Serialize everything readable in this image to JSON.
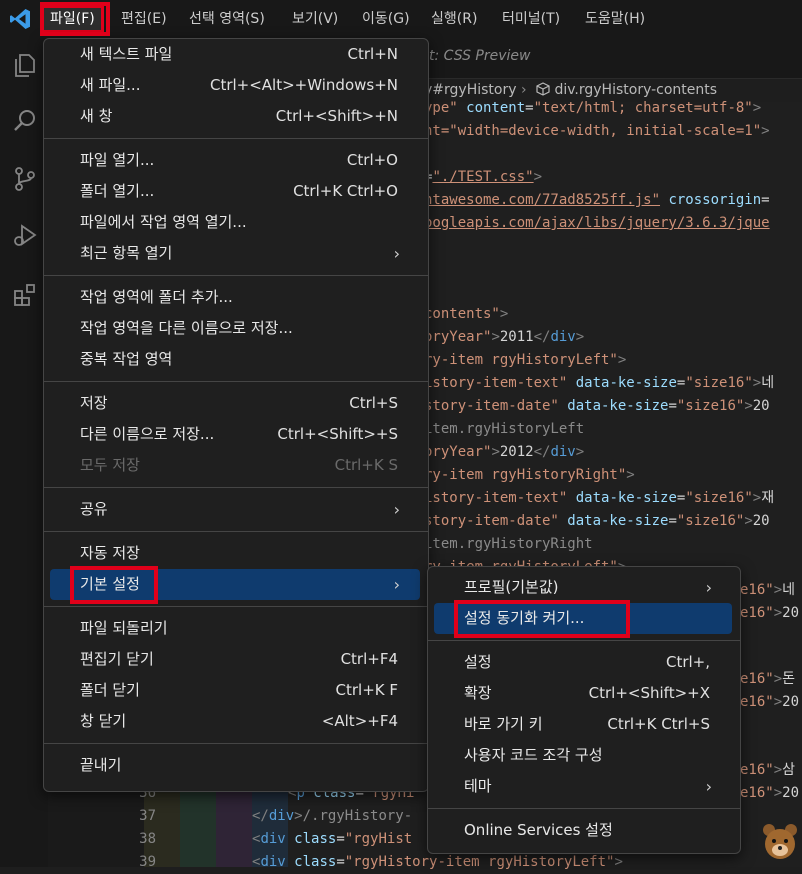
{
  "menubar": {
    "items": [
      "파일(F)",
      "편집(E)",
      "선택 영역(S)",
      "보기(V)",
      "이동(G)",
      "실행(R)",
      "터미널(T)",
      "도움말(H)"
    ],
    "active_index": 0
  },
  "editor": {
    "tab_title": "t: CSS Preview",
    "breadcrumb_a": "v#rgyHistory",
    "breadcrumb_b": "div.rgyHistory-contents",
    "line_numbers": [
      "36",
      "37",
      "38",
      "39"
    ]
  },
  "file_menu": {
    "groups": [
      [
        {
          "label": "새 텍스트 파일",
          "shortcut": "Ctrl+N"
        },
        {
          "label": "새 파일...",
          "shortcut": "Ctrl+<Alt>+Windows+N"
        },
        {
          "label": "새 창",
          "shortcut": "Ctrl+<Shift>+N"
        }
      ],
      [
        {
          "label": "파일 열기...",
          "shortcut": "Ctrl+O"
        },
        {
          "label": "폴더 열기...",
          "shortcut": "Ctrl+K Ctrl+O"
        },
        {
          "label": "파일에서 작업 영역 열기...",
          "shortcut": ""
        },
        {
          "label": "최근 항목 열기",
          "shortcut": "",
          "submenu": true
        }
      ],
      [
        {
          "label": "작업 영역에 폴더 추가...",
          "shortcut": ""
        },
        {
          "label": "작업 영역을 다른 이름으로 저장...",
          "shortcut": ""
        },
        {
          "label": "중복 작업 영역",
          "shortcut": ""
        }
      ],
      [
        {
          "label": "저장",
          "shortcut": "Ctrl+S"
        },
        {
          "label": "다른 이름으로 저장...",
          "shortcut": "Ctrl+<Shift>+S"
        },
        {
          "label": "모두 저장",
          "shortcut": "Ctrl+K S",
          "disabled": true
        }
      ],
      [
        {
          "label": "공유",
          "shortcut": "",
          "submenu": true
        }
      ],
      [
        {
          "label": "자동 저장",
          "shortcut": ""
        },
        {
          "label": "기본 설정",
          "shortcut": "",
          "submenu": true,
          "highlighted": true
        }
      ],
      [
        {
          "label": "파일 되돌리기",
          "shortcut": ""
        },
        {
          "label": "편집기 닫기",
          "shortcut": "Ctrl+F4"
        },
        {
          "label": "폴더 닫기",
          "shortcut": "Ctrl+K F"
        },
        {
          "label": "창 닫기",
          "shortcut": "<Alt>+F4"
        }
      ],
      [
        {
          "label": "끝내기",
          "shortcut": ""
        }
      ]
    ]
  },
  "pref_menu": {
    "groups": [
      [
        {
          "label": "프로필(기본값)",
          "shortcut": "",
          "submenu": true
        },
        {
          "label": "설정 동기화 켜기...",
          "shortcut": "",
          "highlighted": true
        }
      ],
      [
        {
          "label": "설정",
          "shortcut": "Ctrl+,"
        },
        {
          "label": "확장",
          "shortcut": "Ctrl+<Shift>+X"
        },
        {
          "label": "바로 가기 키",
          "shortcut": "Ctrl+K Ctrl+S"
        },
        {
          "label": "사용자 코드 조각 구성",
          "shortcut": ""
        },
        {
          "label": "테마",
          "shortcut": "",
          "submenu": true
        }
      ],
      [
        {
          "label": "Online Services 설정",
          "shortcut": ""
        }
      ]
    ]
  },
  "code": {
    "l1": [
      [
        "c-str",
        "ype\""
      ],
      [
        "c-attr",
        " content"
      ],
      [
        "c-txt",
        "="
      ],
      [
        "c-str",
        "\"text/html; charset=utf-8\""
      ],
      [
        "c-tag",
        ">"
      ]
    ],
    "l2": [
      [
        "c-str",
        "nt=\"width=device-width, initial-scale=1\""
      ],
      [
        "c-tag",
        ">"
      ]
    ],
    "l3": [
      [
        "c-txt",
        "="
      ],
      [
        "c-link",
        "\"./TEST.css\""
      ],
      [
        "c-tag",
        ">"
      ]
    ],
    "l4": [
      [
        "c-link",
        "ntawesome.com/77ad8525ff.js\""
      ],
      [
        "c-attr",
        " crossorigin"
      ],
      [
        "c-txt",
        "="
      ]
    ],
    "l5": [
      [
        "c-link",
        "oogleapis.com/ajax/libs/jquery/3.6.3/jque"
      ]
    ],
    "l6": [
      [
        "c-str",
        "contents\""
      ],
      [
        "c-tag",
        ">"
      ]
    ],
    "l7": [
      [
        "c-str",
        "oryYear\""
      ],
      [
        "c-tag",
        ">"
      ],
      [
        "c-txt",
        "2011"
      ],
      [
        "c-tag",
        "</"
      ],
      [
        "c-name",
        "div"
      ],
      [
        "c-tag",
        ">"
      ]
    ],
    "l8": [
      [
        "c-str",
        "ry-item rgyHistoryLeft\""
      ],
      [
        "c-tag",
        ">"
      ]
    ],
    "l9": [
      [
        "c-str",
        "istory-item-text\""
      ],
      [
        "c-attr",
        " data-ke-size"
      ],
      [
        "c-txt",
        "="
      ],
      [
        "c-str",
        "\"size16\""
      ],
      [
        "c-tag",
        ">"
      ],
      [
        "c-txt",
        "네"
      ]
    ],
    "l10": [
      [
        "c-str",
        "story-item-date\""
      ],
      [
        "c-attr",
        " data-ke-size"
      ],
      [
        "c-txt",
        "="
      ],
      [
        "c-str",
        "\"size16\""
      ],
      [
        "c-tag",
        ">"
      ],
      [
        "c-txt",
        "20"
      ]
    ],
    "l11": [
      [
        "c-gray",
        "item.rgyHistoryLeft"
      ]
    ],
    "l12": [
      [
        "c-str",
        "oryYear\""
      ],
      [
        "c-tag",
        ">"
      ],
      [
        "c-txt",
        "2012"
      ],
      [
        "c-tag",
        "</"
      ],
      [
        "c-name",
        "div"
      ],
      [
        "c-tag",
        ">"
      ]
    ],
    "l13": [
      [
        "c-str",
        "ry-item rgyHistoryRight\""
      ],
      [
        "c-tag",
        ">"
      ]
    ],
    "l14": [
      [
        "c-str",
        "istory-item-text\""
      ],
      [
        "c-attr",
        " data-ke-size"
      ],
      [
        "c-txt",
        "="
      ],
      [
        "c-str",
        "\"size16\""
      ],
      [
        "c-tag",
        ">"
      ],
      [
        "c-txt",
        "재"
      ]
    ],
    "l15": [
      [
        "c-str",
        "story-item-date\""
      ],
      [
        "c-attr",
        " data-ke-size"
      ],
      [
        "c-txt",
        "="
      ],
      [
        "c-str",
        "\"size16\""
      ],
      [
        "c-tag",
        ">"
      ],
      [
        "c-txt",
        "20"
      ]
    ],
    "l16": [
      [
        "c-gray",
        "item.rgyHistoryRight"
      ]
    ],
    "l17": [
      [
        "c-str",
        "ry-item rgyHistoryLeft\""
      ],
      [
        "c-tag",
        ">"
      ]
    ],
    "r1": [
      [
        "c-str",
        "e16\""
      ],
      [
        "c-tag",
        ">"
      ],
      [
        "c-txt",
        "네"
      ]
    ],
    "r2": [
      [
        "c-str",
        "e16\""
      ],
      [
        "c-tag",
        ">"
      ],
      [
        "c-txt",
        "20"
      ]
    ],
    "r3": [
      [
        "c-str",
        "e16\""
      ],
      [
        "c-tag",
        ">"
      ],
      [
        "c-txt",
        "돈"
      ]
    ],
    "r4": [
      [
        "c-str",
        "e16\""
      ],
      [
        "c-tag",
        ">"
      ],
      [
        "c-txt",
        "20"
      ]
    ],
    "r5": [
      [
        "c-str",
        "e16\""
      ],
      [
        "c-tag",
        ">"
      ],
      [
        "c-txt",
        "삼"
      ]
    ],
    "r6": [
      [
        "c-str",
        "e16\""
      ],
      [
        "c-tag",
        ">"
      ],
      [
        "c-txt",
        "20"
      ]
    ],
    "b36": [
      [
        "c-tag",
        "<"
      ],
      [
        "c-name",
        "p"
      ],
      [
        "c-attr",
        " class"
      ],
      [
        "c-txt",
        "="
      ],
      [
        "c-str",
        "\"rgyHi"
      ]
    ],
    "b37": [
      [
        "c-tag",
        "</"
      ],
      [
        "c-name",
        "div"
      ],
      [
        "c-tag",
        ">"
      ],
      [
        "c-gray",
        "/.rgyHistory-"
      ]
    ],
    "b38": [
      [
        "c-tag",
        "<"
      ],
      [
        "c-name",
        "div"
      ],
      [
        "c-attr",
        " class"
      ],
      [
        "c-txt",
        "="
      ],
      [
        "c-str",
        "\"rgyHist"
      ]
    ],
    "b39": [
      [
        "c-tag",
        "<"
      ],
      [
        "c-name",
        "div"
      ],
      [
        "c-attr",
        " class"
      ],
      [
        "c-txt",
        "="
      ],
      [
        "c-str",
        "\"rgyHistory-item rgyHistoryLeft\""
      ],
      [
        "c-tag",
        ">"
      ]
    ]
  }
}
